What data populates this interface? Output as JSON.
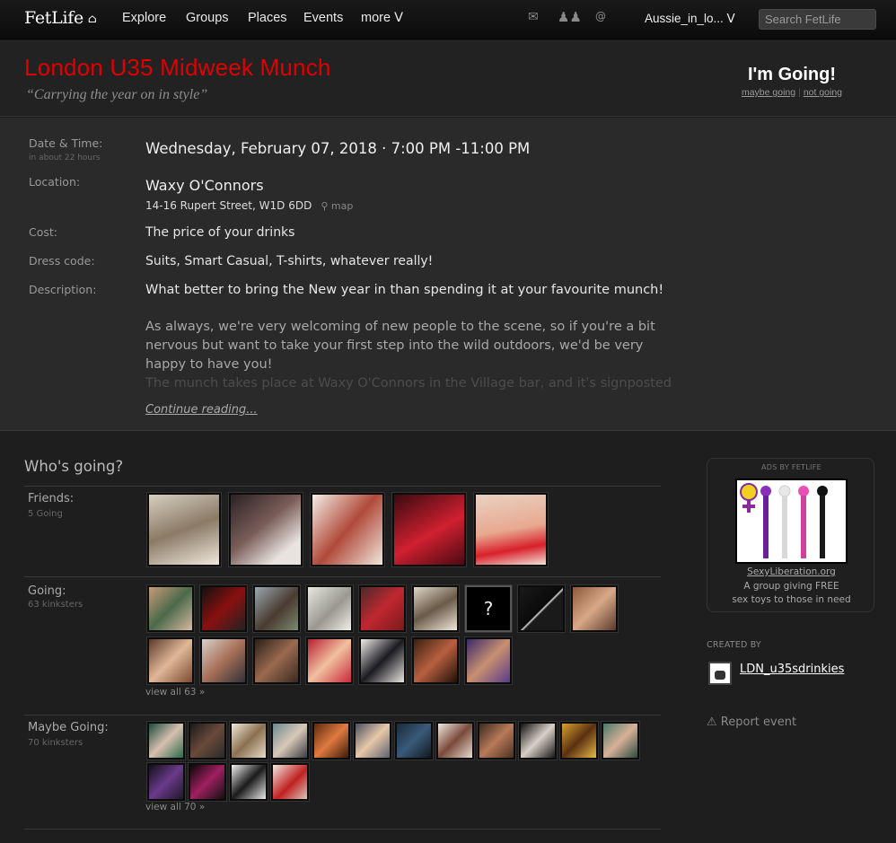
{
  "nav": {
    "logo": "FetLife",
    "links": [
      "Explore",
      "Groups",
      "Places",
      "Events",
      "more ᐯ"
    ],
    "user": "Aussie_in_lo... ᐯ",
    "search_placeholder": "Search FetLife"
  },
  "event": {
    "title": "London U35 Midweek Munch",
    "tagline": "“Carrying the year on in style”",
    "rsvp_status": "I'm Going!",
    "maybe": "maybe going",
    "not": "not going"
  },
  "details": {
    "date_label": "Date & Time:",
    "date_sub": "in about 22 hours",
    "date_value": "Wednesday, February 07, 2018 · 7:00 PM -11:00 PM",
    "location_label": "Location:",
    "venue": "Waxy O'Connors",
    "address": "14-16 Rupert Street, W1D 6DD",
    "map": "map",
    "cost_label": "Cost:",
    "cost": "The price of your drinks",
    "dress_label": "Dress code:",
    "dress": "Suits, Smart Casual, T-shirts, whatever really!",
    "desc_label": "Description:",
    "desc_p1": "What better to bring the New year in than spending it at your favourite munch!",
    "desc_p2": "As always, we're very welcoming of new people to the scene, so if you're a bit nervous but want to take your first step into the wild outdoors, we'd be very happy to have you!",
    "desc_p3": "The munch takes place at Waxy O'Connors in the Village bar, and it's signposted for",
    "continue": "Continue reading..."
  },
  "attendees": {
    "heading": "Who's going?",
    "friends_label": "Friends:",
    "friends_sub": "5 Going",
    "going_label": "Going:",
    "going_sub": "63 kinksters",
    "going_viewall": "view all 63 »",
    "maybe_label": "Maybe Going:",
    "maybe_sub": "70 kinksters",
    "maybe_viewall": "view all 70 »",
    "unknown_mark": "?"
  },
  "sidebar": {
    "ad_label": "ADS BY FETLIFE",
    "ad_link": "SexyLiberation.org",
    "ad_text_1": "A group giving FREE",
    "ad_text_2": "sex toys to those in need",
    "created_by": "CREATED BY",
    "creator": "LDN_u35sdrinkies",
    "report": "Report event"
  },
  "colors": {
    "title": "#e00000",
    "background": "#1e1e1f"
  }
}
